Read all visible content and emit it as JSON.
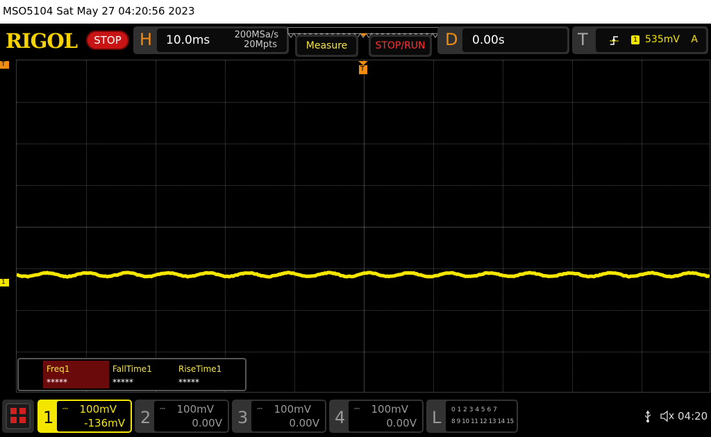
{
  "titlebar": {
    "text": "MSO5104  Sat May 27 04:20:56 2023"
  },
  "brand": {
    "logo": "RIGOL",
    "run_state": "STOP"
  },
  "horizontal": {
    "letter": "H",
    "timebase": "10.0ms",
    "sample_rate": "200MSa/s",
    "memory_depth": "20Mpts"
  },
  "buttons": {
    "measure": "Measure",
    "stop_run": "STOP/RUN"
  },
  "delay": {
    "letter": "D",
    "value": "0.00s"
  },
  "trigger": {
    "letter": "T",
    "source": "1",
    "level": "535mV",
    "mode": "A",
    "edge_icon": "rising-edge-icon",
    "marker": "T"
  },
  "markers": {
    "trigger_level": "T",
    "ch1_ground": "1",
    "trigger_position": "T"
  },
  "measurements": [
    {
      "name": "Freq1",
      "value": "*****",
      "selected": true
    },
    {
      "name": "FallTime1",
      "value": "*****",
      "selected": false
    },
    {
      "name": "RiseTime1",
      "value": "*****",
      "selected": false
    }
  ],
  "channels": [
    {
      "num": "1",
      "coupling": "DC",
      "scale": "100mV",
      "offset": "-136mV",
      "active": true,
      "color": "#f5e600"
    },
    {
      "num": "2",
      "coupling": "DC",
      "scale": "100mV",
      "offset": "0.00V",
      "active": false,
      "color": "#9a9a9a"
    },
    {
      "num": "3",
      "coupling": "DC",
      "scale": "100mV",
      "offset": "0.00V",
      "active": false,
      "color": "#9a9a9a"
    },
    {
      "num": "4",
      "coupling": "DC",
      "scale": "100mV",
      "offset": "0.00V",
      "active": false,
      "color": "#9a9a9a"
    }
  ],
  "logic": {
    "letter": "L",
    "row1": "0 1 2 3  4 5 6 7",
    "row2": "8 9 10 11 12 13 14 15"
  },
  "status": {
    "usb_icon": "usb-icon",
    "sound_icon": "mute-icon",
    "time": "04:20"
  },
  "colors": {
    "ch1": "#f5e600",
    "accent": "#f08c10",
    "stop": "#c81414",
    "measure_text": "#f5e64a",
    "stop_run_text": "#ff3030"
  }
}
